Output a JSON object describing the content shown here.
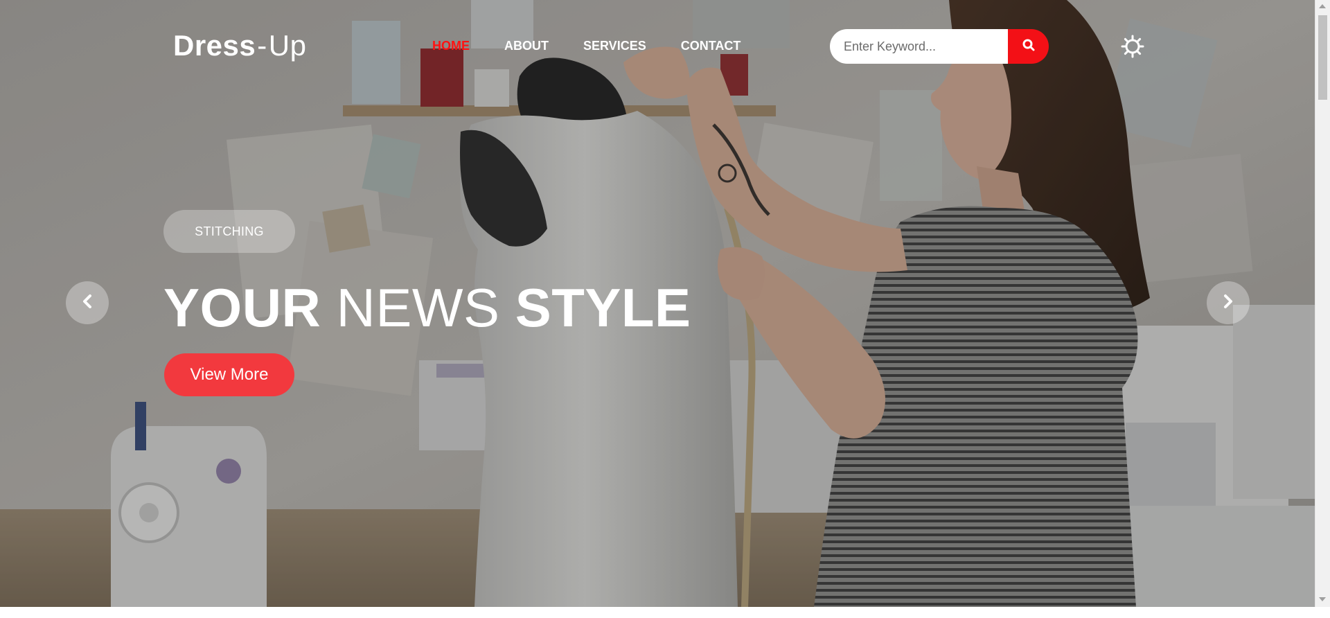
{
  "brand": {
    "name_bold": "Dress",
    "separator": "-",
    "name_light": "Up"
  },
  "nav": {
    "items": [
      {
        "label": "HOME",
        "active": true
      },
      {
        "label": "ABOUT",
        "active": false
      },
      {
        "label": "SERVICES",
        "active": false
      },
      {
        "label": "CONTACT",
        "active": false
      }
    ]
  },
  "search": {
    "placeholder": "Enter Keyword...",
    "value": "",
    "button_icon": "search-icon"
  },
  "settings": {
    "icon": "gear-icon"
  },
  "hero": {
    "tag": "STITCHING",
    "headline_part1": "YOUR",
    "headline_part2": "NEWS",
    "headline_part3": "STYLE",
    "cta_label": "View More",
    "prev_icon": "chevron-left-icon",
    "next_icon": "chevron-right-icon"
  },
  "colors": {
    "accent": "#f31016",
    "cta": "#f2393e",
    "nav_active": "#ff1212",
    "text": "#ffffff"
  }
}
